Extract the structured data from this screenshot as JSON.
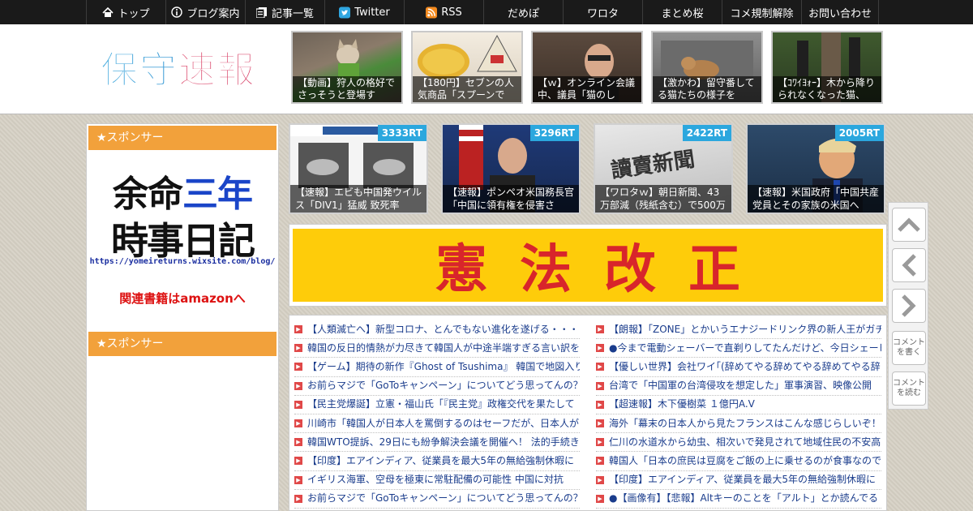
{
  "nav": {
    "items": [
      {
        "label": "トップ",
        "icon": "home-icon"
      },
      {
        "label": "ブログ案内",
        "icon": "info-icon"
      },
      {
        "label": "記事一覧",
        "icon": "list-icon"
      },
      {
        "label": "Twitter",
        "icon": "twitter-icon"
      },
      {
        "label": "RSS",
        "icon": "rss-icon"
      },
      {
        "label": "だめぽ"
      },
      {
        "label": "ワロタ"
      },
      {
        "label": "まとめ桜"
      },
      {
        "label": "コメ規制解除"
      },
      {
        "label": "お問い合わせ"
      }
    ]
  },
  "header": {
    "logo_text": "保守速報",
    "thumbs": [
      {
        "caption": "【動画】狩人の格好でさっそうと登場す"
      },
      {
        "caption": "【180円】セブンの人気商品「スプーンで"
      },
      {
        "caption": "【ｗ】オンライン会議中、議員「猫のし"
      },
      {
        "caption": "【激かわ】留守番してる猫たちの様子を"
      },
      {
        "caption": "【ｺﾜｲﾖｫｰ】木から降りられなくなった猫、"
      }
    ]
  },
  "sidebar": {
    "sponsor_label": "★スポンサー",
    "ad": {
      "line1_a": "余命",
      "line1_b": "三年",
      "line2": "時事日記",
      "url": "https://yomeireturns.wixsite.com/blog/",
      "link": "関連書籍はamazonへ"
    },
    "sponsor_label_2": "★スポンサー"
  },
  "featured": [
    {
      "rt": "3333RT",
      "caption": "【速報】エビも中国発ウイルス「DIV1」猛威 致死率"
    },
    {
      "rt": "3296RT",
      "caption": "【速報】ポンペオ米国務長官「中国に領有権を侵害さ"
    },
    {
      "rt": "2422RT",
      "caption": "【ワロタｗ】朝日新聞、43万部減（残紙含む）で500万"
    },
    {
      "rt": "2005RT",
      "caption": "【速報】米国政府「中国共産党員とその家族の米国へ"
    }
  ],
  "banner": {
    "text": "憲法改正"
  },
  "feed": {
    "left": [
      "【人類滅亡へ】新型コロナ、とんでもない進化を遂げる・・・",
      "韓国の反日的情熱が力尽きて韓国人が中途半端すぎる言い訳を",
      "【ゲーム】期待の新作『Ghost of Tsushima』 韓国で地図入りの",
      "お前らマジで「GoToキャンペーン」についてどう思ってんの？",
      "【民主党爆誕】立憲・福山氏「『民主党』政権交代を果たして",
      "川崎市「韓国人が日本人を罵倒するのはセーフだが、日本人が",
      "韓国WTO提訴、29日にも紛争解決会議を開催へ！ 法的手続き",
      "【印度】エアインディア、従業員を最大5年の無給強制休暇に",
      "イギリス海軍、空母を極東に常駐配備の可能性 中国に対抗",
      "お前らマジで「GoToキャンペーン」についてどう思ってんの？"
    ],
    "right": [
      "【朗報】「ZONE」とかいうエナジードリンク界の新人王がガチ",
      "●今まで電動シェーバーで直剃りしてたんだけど、今日シェービ",
      "【優しい世界】会社ワイ｢(辞めてやる辞めてやる辞めてやる辞",
      "台湾で「中国軍の台湾侵攻を想定した」軍事演習、映像公開",
      "【超速報】木下優樹菜 １億円A.V",
      "海外「幕末の日本人から見たフランスはこんな感じらしいぞ！",
      "仁川の水道水から幼虫、相次いで発見されて地域住民の不安高",
      "韓国人「日本の庶民は豆腐をご飯の上に乗せるのが食事なので",
      "【印度】エアインディア、従業員を最大5年の無給強制休暇に",
      "●【画像有】【悲報】Altキーのことを「アルト」とか読んでる"
    ]
  },
  "sidenav": {
    "write_comment": "コメントを書く",
    "read_comment": "コメントを読む"
  },
  "colors": {
    "nav_bg": "#1a1a1a",
    "sponsor_header": "#f2a13b",
    "rt_badge": "#2ba7de",
    "banner_bg": "#fecc0a",
    "banner_text": "#d8252b",
    "link": "#1a3c8c"
  }
}
